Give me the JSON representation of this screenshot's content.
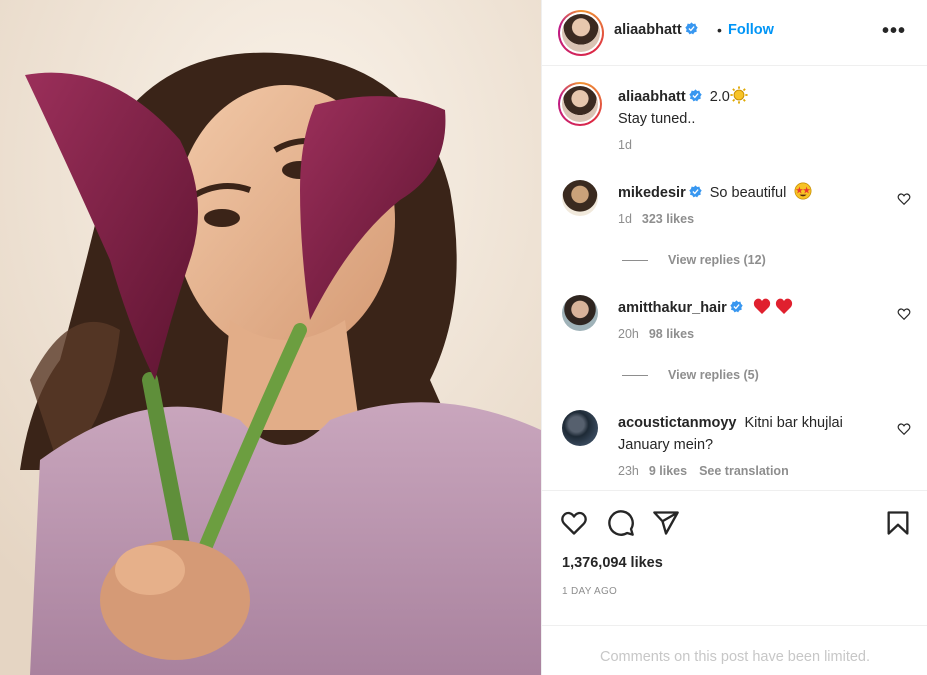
{
  "post": {
    "author": "aliaabhatt",
    "follow_label": "Follow",
    "separator": "•",
    "more_label": "•••",
    "caption": {
      "username": "aliaabhatt",
      "text": "2.0",
      "emoji": "sun",
      "line2": "Stay tuned..",
      "time": "1d"
    },
    "comments": [
      {
        "username": "mikedesir",
        "text": "So beautiful",
        "emoji": "star-struck",
        "time": "1d",
        "likes": "323 likes",
        "replies": "View replies (12)"
      },
      {
        "username": "amitthakur_hair",
        "text": "",
        "emoji": "two-hearts",
        "time": "20h",
        "likes": "98 likes",
        "replies": "View replies (5)"
      },
      {
        "username": "acoustictanmoyy",
        "text": "Kitni bar khujlai",
        "line2": "January mein?",
        "time": "23h",
        "likes": "9 likes",
        "extra": "See translation"
      }
    ],
    "likes_count": "1,376,094 likes",
    "posted_ago": "1 DAY AGO",
    "limited_notice": "Comments on this post have been limited."
  },
  "icons": {
    "like": "heart-icon",
    "comment": "comment-icon",
    "share": "paper-plane-icon",
    "save": "bookmark-icon",
    "verified": "verified-badge-icon"
  },
  "colors": {
    "follow_blue": "#0095f6",
    "verified_blue": "#3897f0",
    "muted": "#8e8e8e",
    "limited_text": "#c7c7c7",
    "heart_red": "#ed4956"
  }
}
